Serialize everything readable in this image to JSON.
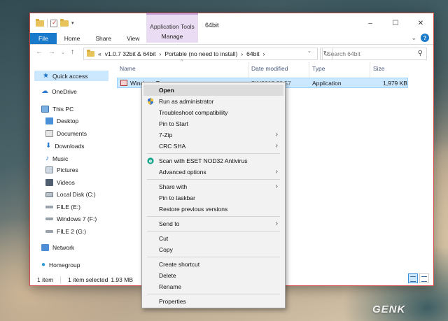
{
  "window": {
    "title": "64bit",
    "contextual_group": "Application Tools",
    "controls": [
      "–",
      "☐",
      "✕"
    ]
  },
  "ribbon": {
    "tabs": [
      "File",
      "Home",
      "Share",
      "View"
    ],
    "manage": "Manage",
    "help": "?"
  },
  "address": {
    "path_prefix": "«",
    "segments": [
      "v1.0.7 32bit & 64bit",
      "Portable (no need to install)",
      "64bit"
    ],
    "separator": "›",
    "search_placeholder": "Search 64bit"
  },
  "sidebar": {
    "items": [
      {
        "label": "Quick access"
      },
      {
        "label": "OneDrive"
      },
      {
        "label": "This PC"
      },
      {
        "label": "Desktop"
      },
      {
        "label": "Documents"
      },
      {
        "label": "Downloads"
      },
      {
        "label": "Music"
      },
      {
        "label": "Pictures"
      },
      {
        "label": "Videos"
      },
      {
        "label": "Local Disk (C:)"
      },
      {
        "label": "FILE (E:)"
      },
      {
        "label": "Windows 7 (F:)"
      },
      {
        "label": "FILE 2 (G:)"
      },
      {
        "label": "Network"
      },
      {
        "label": "Homegroup"
      }
    ]
  },
  "columns": {
    "name": "Name",
    "date": "Date modified",
    "type": "Type",
    "size": "Size"
  },
  "file": {
    "name": "Windows T",
    "date": "7/1/2017 20:57",
    "type": "Application",
    "size": "1,979 KB"
  },
  "status": {
    "count": "1 item",
    "selected": "1 item selected",
    "size": "1.93 MB"
  },
  "context_menu": {
    "items": [
      {
        "label": "Open"
      },
      {
        "label": "Run as administrator"
      },
      {
        "label": "Troubleshoot compatibility"
      },
      {
        "label": "Pin to Start"
      },
      {
        "label": "7-Zip"
      },
      {
        "label": "CRC SHA"
      },
      {
        "label": "Scan with ESET NOD32 Antivirus"
      },
      {
        "label": "Advanced options"
      },
      {
        "label": "Share with"
      },
      {
        "label": "Pin to taskbar"
      },
      {
        "label": "Restore previous versions"
      },
      {
        "label": "Send to"
      },
      {
        "label": "Cut"
      },
      {
        "label": "Copy"
      },
      {
        "label": "Create shortcut"
      },
      {
        "label": "Delete"
      },
      {
        "label": "Rename"
      },
      {
        "label": "Properties"
      }
    ]
  },
  "watermark": "GENK",
  "colors": {
    "accent": "#1979ca",
    "selection": "#cce8ff",
    "window_border": "#d34c4c",
    "app_tools": "#eadcf2"
  }
}
